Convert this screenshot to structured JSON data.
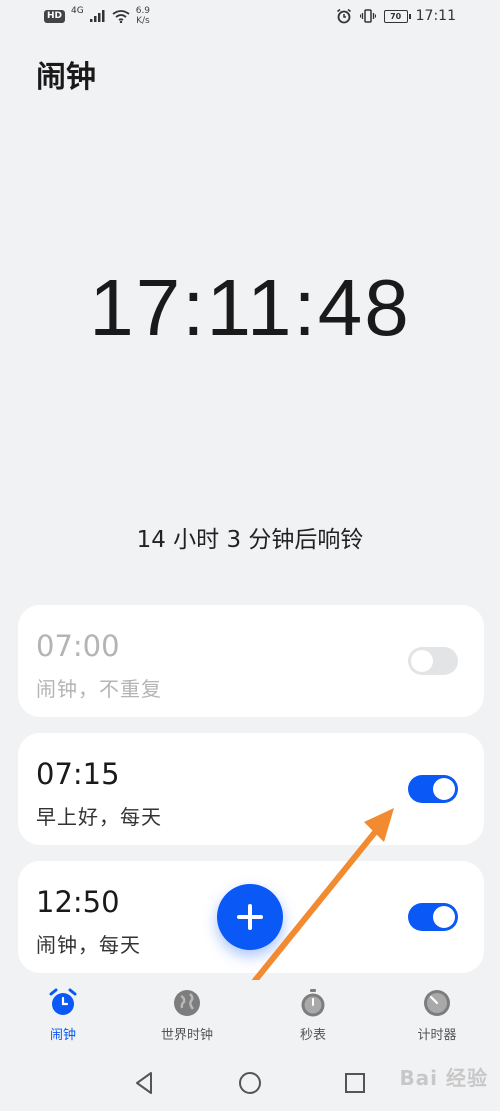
{
  "status_bar": {
    "hd_badge": "HD",
    "network_type": "4G",
    "speed_value": "6.9",
    "speed_unit": "K/s",
    "battery": "70",
    "time": "17:11"
  },
  "page_title": "闹钟",
  "clock": {
    "time": "17:11:48",
    "next_ring": "14 小时 3 分钟后响铃"
  },
  "alarms": [
    {
      "time": "07:00",
      "label": "闹钟，不重复",
      "enabled": false
    },
    {
      "time": "07:15",
      "label": "早上好，每天",
      "enabled": true
    },
    {
      "time": "12:50",
      "label": "闹钟，每天",
      "enabled": true
    }
  ],
  "fab": {
    "icon": "plus-icon"
  },
  "bottom_nav": {
    "items": [
      {
        "label": "闹钟",
        "icon": "alarm-clock-icon",
        "active": true
      },
      {
        "label": "世界时钟",
        "icon": "globe-icon",
        "active": false
      },
      {
        "label": "秒表",
        "icon": "stopwatch-icon",
        "active": false
      },
      {
        "label": "计时器",
        "icon": "timer-icon",
        "active": false
      }
    ]
  },
  "system_nav": {
    "back": "back-icon",
    "home": "home-icon",
    "recents": "recents-icon"
  },
  "watermark": "Bai 经验",
  "colors": {
    "accent": "#0a59f7",
    "background": "#f1f2f4",
    "card": "#ffffff",
    "disabled_text": "#b4b4b4",
    "annotation_arrow": "#f28a30"
  }
}
